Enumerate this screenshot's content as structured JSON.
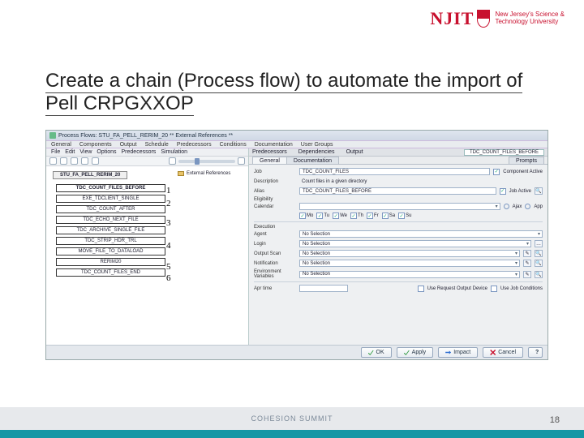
{
  "logo": {
    "text": "NJIT",
    "sub1": "New Jersey's Science &",
    "sub2": "Technology University"
  },
  "title": {
    "line1": "Create a chain (Process flow) to automate the",
    "line2": "import of Pell CRPGXXOP"
  },
  "window": {
    "title": "Process Flows: STU_FA_PELL_RERIM_20 ** External References **",
    "menus": [
      "General",
      "Components",
      "Output",
      "Schedule",
      "Predecessors",
      "Conditions",
      "Documentation",
      "User Groups"
    ]
  },
  "left": {
    "menus": [
      "File",
      "Edit",
      "View",
      "Options",
      "Predecessors",
      "Simulation"
    ],
    "ext_ref": "External References",
    "chain_name": "STU_FA_PELL_RERIM_20",
    "boxes": [
      "TDC_COUNT_FILES_BEFORE",
      "EXE_TDCLIENT_SINGLE",
      "TDC_COUNT_AFTER",
      "TDC_ECHO_NEXT_FILE",
      "TDC_ARCHIVE_SINGLE_FILE",
      "TDC_STRIP_HDR_TRL",
      "MOVE_FILE_TO_DATALOAD",
      "RERIM20",
      "TDC_COUNT_FILES_END"
    ],
    "nums": [
      "1",
      "2",
      "3",
      "4",
      "5",
      "6"
    ]
  },
  "right": {
    "upper_tabs": [
      "Predecessors",
      "Dependencies",
      "Output"
    ],
    "top_field": "TDC_COUNT_FILES_BEFORE",
    "tabs": [
      "General",
      "Documentation",
      "Prompts"
    ],
    "labels": {
      "job": "Job",
      "description": "Description",
      "alias": "Alias",
      "component_active": "Component Active",
      "job_active": "Job Active",
      "eligibility": "Eligibility",
      "calendar": "Calendar",
      "ajax": "Ajax",
      "app": "App",
      "execution": "Execution",
      "agent": "Agent",
      "login": "Login",
      "output_scan": "Output Scan",
      "notification": "Notification",
      "env_vars": "Environment Variables",
      "apr_time": "Apr time",
      "use_request_output": "Use Request Output Device",
      "use_job_conditions": "Use Job Conditions"
    },
    "values": {
      "job": "TDC_COUNT_FILES",
      "description": "Count files in a given directory",
      "alias": "TDC_COUNT_FILES_BEFORE",
      "calendar": "",
      "agent": "No Selection",
      "login": "No Selection",
      "output_scan": "No Selection",
      "notification": "No Selection",
      "env_vars": "No Selection"
    },
    "days": [
      "Mo",
      "Tu",
      "We",
      "Th",
      "Fr",
      "Sa",
      "Su"
    ]
  },
  "buttons": {
    "ok": "OK",
    "apply": "Apply",
    "impact": "Impact",
    "cancel": "Cancel",
    "help": "?"
  },
  "footer": {
    "label": "COHESION SUMMIT",
    "page": "18"
  }
}
